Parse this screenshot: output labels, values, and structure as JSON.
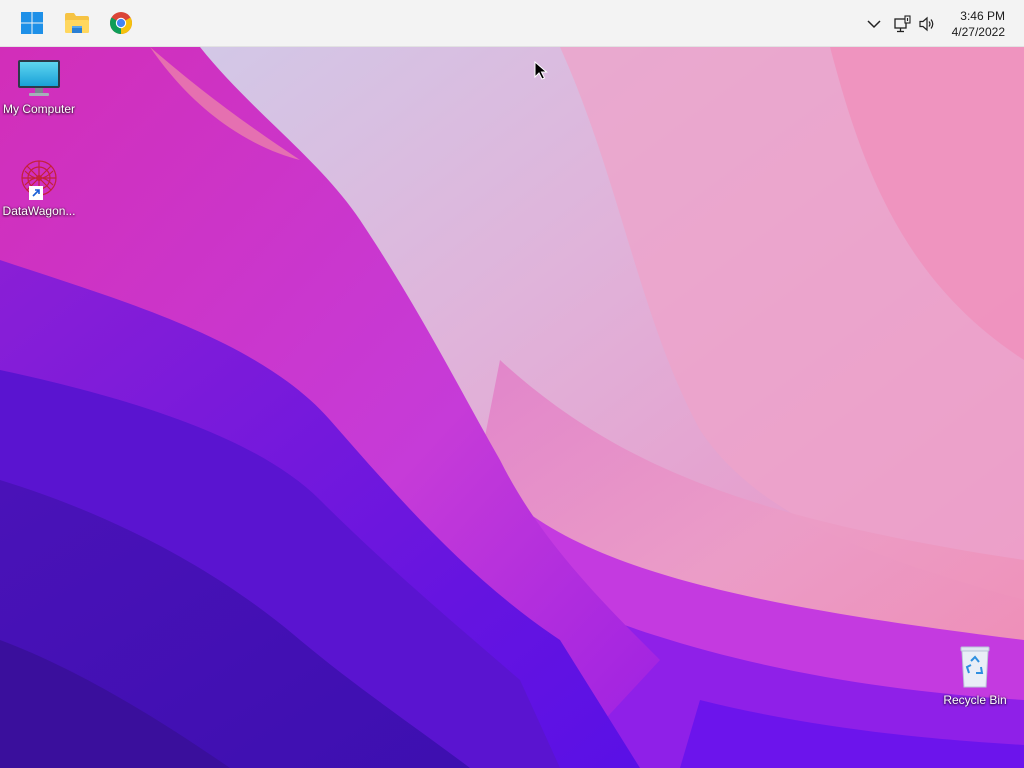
{
  "taskbar": {
    "buttons": [
      {
        "name": "start-button",
        "icon": "windows-logo-icon"
      },
      {
        "name": "file-explorer-button",
        "icon": "folder-icon"
      },
      {
        "name": "chrome-button",
        "icon": "chrome-icon"
      }
    ],
    "tray": {
      "overflow_icon": "chevron-down-icon",
      "network_icon": "network-icon",
      "volume_icon": "volume-icon"
    },
    "clock": {
      "time": "3:46 PM",
      "date": "4/27/2022"
    }
  },
  "desktop": {
    "icons": [
      {
        "label": "My Computer",
        "icon": "monitor-icon"
      },
      {
        "label": "DataWagon...",
        "icon": "datawagon-icon"
      },
      {
        "label": "Recycle Bin",
        "icon": "recycle-bin-icon"
      }
    ]
  },
  "colors": {
    "taskbar_bg": "#f3f3f3",
    "wallpaper_pink": "#e27fc2",
    "wallpaper_purple": "#6a12e0"
  }
}
